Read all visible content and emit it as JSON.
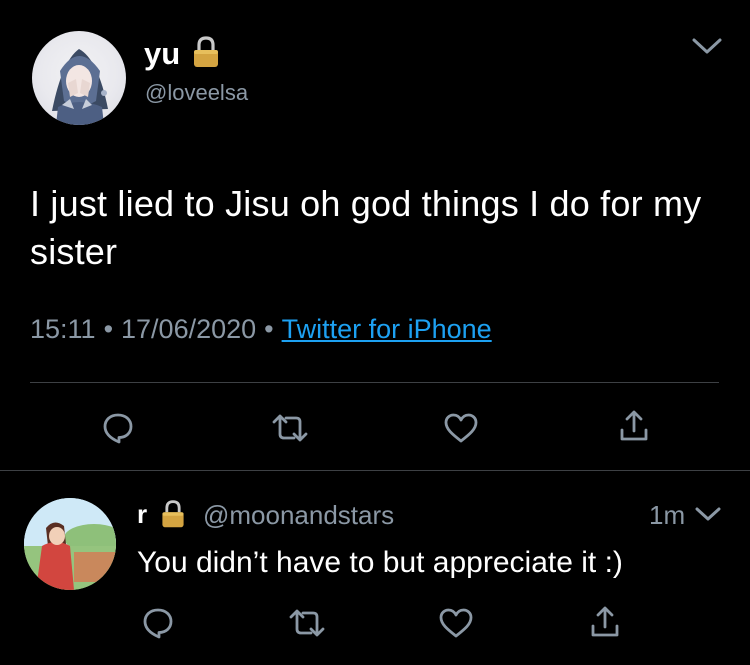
{
  "tweet": {
    "author_name": "yu",
    "author_handle": "@loveelsa",
    "text": "I just lied to Jisu oh god things I do for my sister",
    "time": "15:11",
    "date": "17/06/2020",
    "separator": "•",
    "source": "Twitter for iPhone"
  },
  "reply": {
    "author_name": "r",
    "author_handle": "@moonandstars",
    "time": "1m",
    "text": "You didn’t have to but appreciate it :)"
  },
  "icons": {
    "reply": "reply-icon",
    "retweet": "retweet-icon",
    "like": "heart-icon",
    "share": "share-icon",
    "lock": "lock-icon",
    "more": "chevron-down-icon"
  },
  "colors": {
    "background": "#000000",
    "text": "#ffffff",
    "muted": "#8b98a5",
    "link": "#1da1f2",
    "divider": "#3d4044"
  }
}
